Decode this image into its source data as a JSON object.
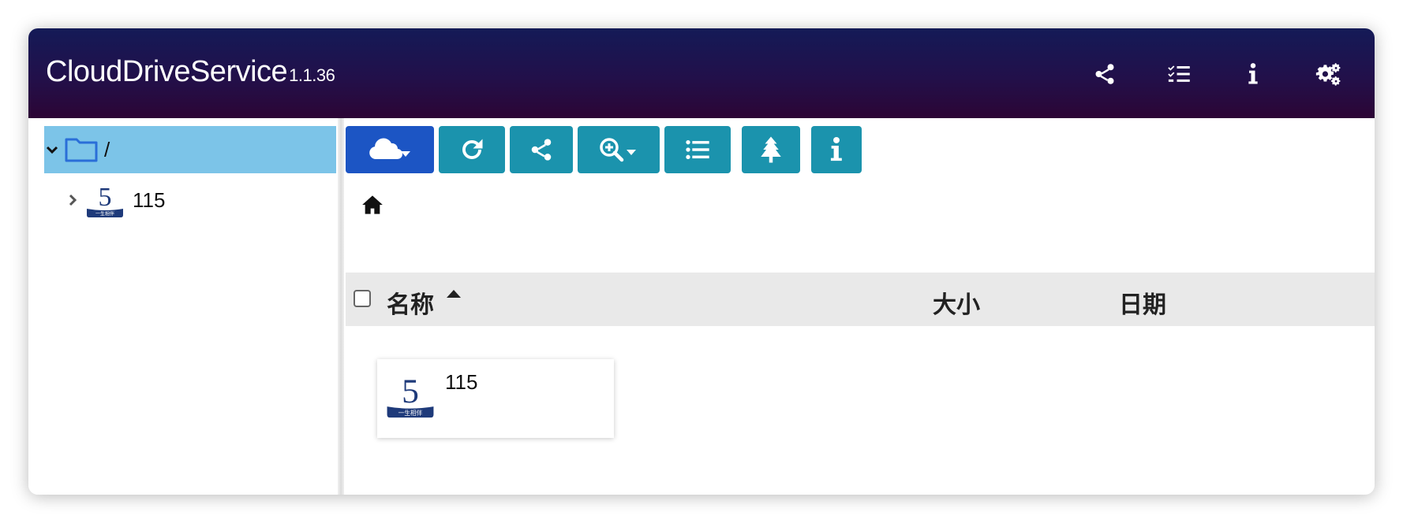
{
  "app": {
    "title": "CloudDriveService",
    "version": "1.1.36"
  },
  "header_icons": [
    "share-icon",
    "task-list-icon",
    "info-icon",
    "settings-icon"
  ],
  "sidebar": {
    "root": {
      "label": "/",
      "expanded": true,
      "selected": true
    },
    "items": [
      {
        "label": "115",
        "expanded": false,
        "logo_text": "一生相伴",
        "logo_digit": "5"
      }
    ]
  },
  "toolbar": {
    "buttons": [
      "cloud-add-menu",
      "refresh",
      "share",
      "search-menu",
      "list-view",
      "tree-view",
      "info"
    ]
  },
  "table": {
    "columns": {
      "name": "名称",
      "size": "大小",
      "date": "日期"
    },
    "sort": {
      "column": "name",
      "direction": "asc"
    }
  },
  "files": [
    {
      "name": "115",
      "logo_digit": "5",
      "logo_text": "一生相伴"
    }
  ],
  "colors": {
    "header_top": "#141a57",
    "header_bottom": "#2c0535",
    "selected_row": "#7cc4e8",
    "primary_button": "#1c55c4",
    "toolbar_button": "#1b93ad",
    "table_header_bg": "#e9e9e9",
    "logo_blue": "#1e3a7a"
  }
}
